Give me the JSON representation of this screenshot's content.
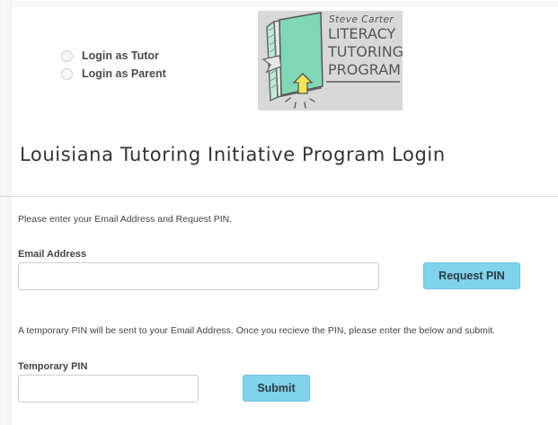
{
  "login_roles": [
    {
      "label": "Login as Tutor",
      "selected": false
    },
    {
      "label": "Login as Parent",
      "selected": false
    }
  ],
  "logo": {
    "line1": "Steve Carter",
    "line2": "LITERACY",
    "line3": "TUTORING",
    "line4": "PROGRAM"
  },
  "page_title": "Louisiana Tutoring Initiative Program Login",
  "email_section": {
    "instruction": "Please enter your Email Address and Request PIN.",
    "label": "Email Address",
    "value": "",
    "button": "Request PIN"
  },
  "pin_section": {
    "instruction": "A temporary PIN will be sent to your Email Address. Once you recieve the PIN, please enter the below and submit.",
    "label": "Temporary PIN",
    "value": "",
    "button": "Submit"
  },
  "colors": {
    "button_bg": "#7fd3ec",
    "logo_bg": "#d8d8d8",
    "book_green": "#7fd7b5"
  }
}
